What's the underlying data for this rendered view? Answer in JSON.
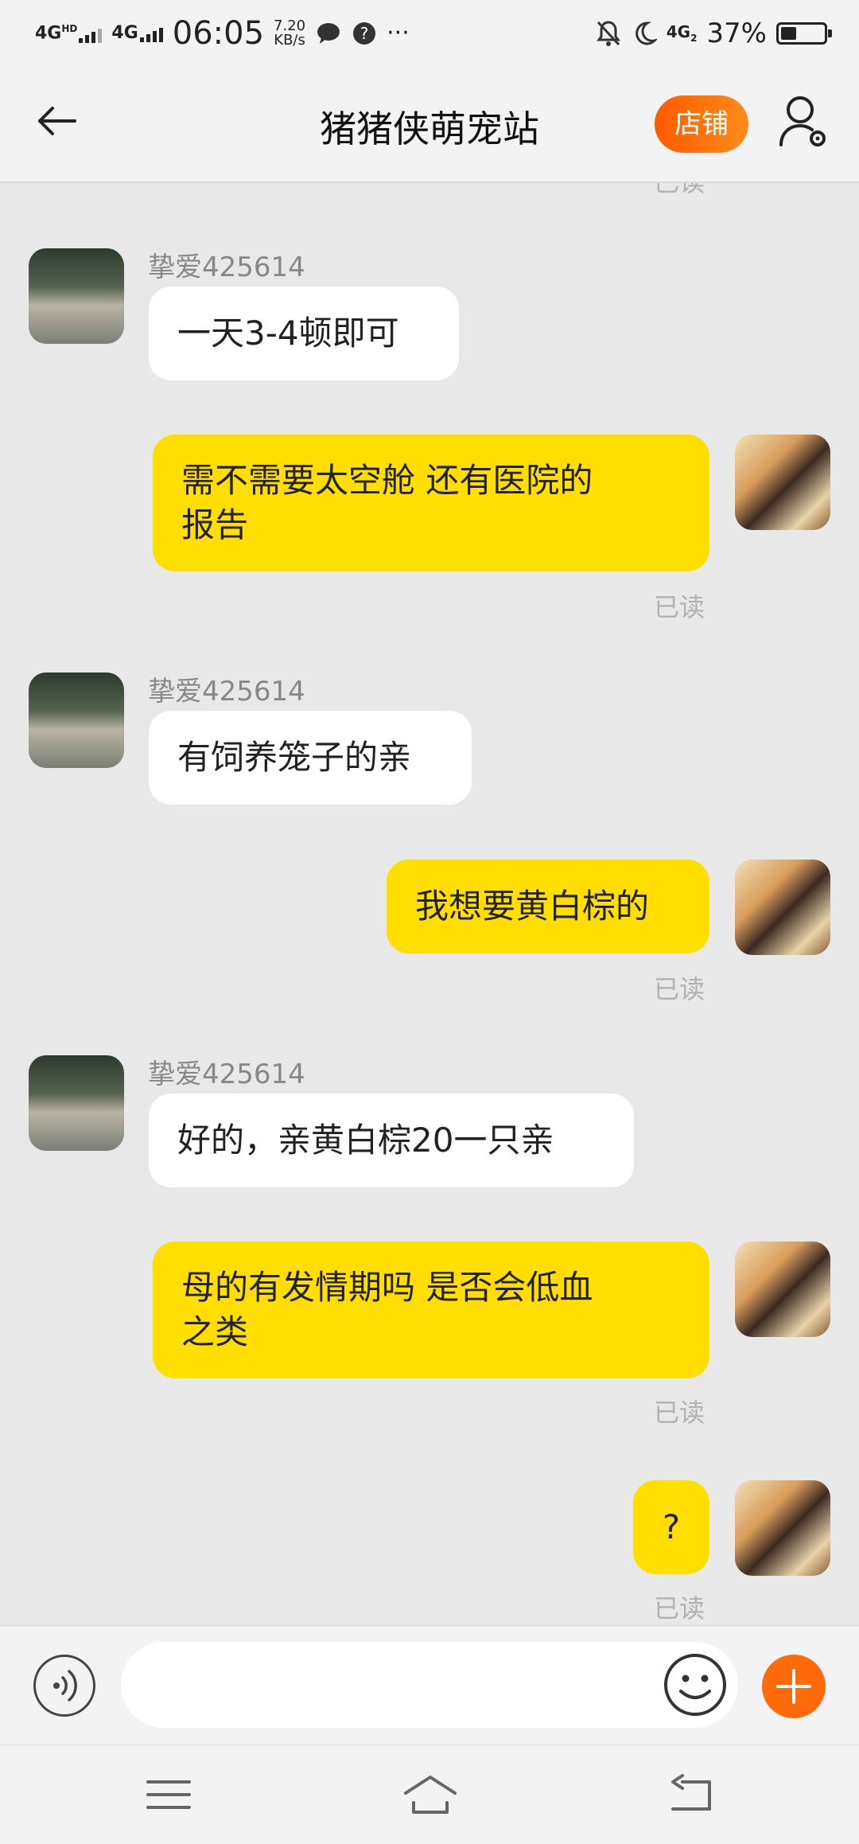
{
  "status_bar": {
    "network1": "4G",
    "network1_sup": "HD",
    "network2": "4G",
    "time": "06:05",
    "speed_value": "7.20",
    "speed_unit": "KB/s",
    "network3": "4G",
    "network3_sub": "2",
    "battery_percent_text": "37%",
    "battery_level": 0.37
  },
  "header": {
    "title": "猪猪侠萌宠站",
    "shop_button": "店铺"
  },
  "chat": {
    "top_read": "已读",
    "messages": [
      {
        "side": "in",
        "sender": "挚爱425614",
        "text": "一天3-4顿即可"
      },
      {
        "side": "out",
        "line1": "需不需要太空舱 还有医院的",
        "line2": "报告",
        "read": "已读"
      },
      {
        "side": "in",
        "sender": "挚爱425614",
        "text": "有饲养笼子的亲"
      },
      {
        "side": "out",
        "text": "我想要黄白棕的",
        "read": "已读"
      },
      {
        "side": "in",
        "sender": "挚爱425614",
        "text": "好的，亲黄白棕20一只亲"
      },
      {
        "side": "out",
        "line1": "母的有发情期吗 是否会低血",
        "line2": "之类",
        "read": "已读"
      },
      {
        "side": "out",
        "text": "?",
        "read": "已读"
      }
    ]
  },
  "input": {
    "placeholder": "",
    "value": ""
  },
  "colors": {
    "outgoing_bubble": "#ffde00",
    "incoming_bubble": "#ffffff",
    "chat_background": "#e8e8e8",
    "accent": "#ff6a0a"
  },
  "icons": [
    "back-arrow-icon",
    "profile-settings-icon",
    "voice-icon",
    "emoji-icon",
    "plus-icon",
    "menu-icon",
    "home-icon",
    "return-icon"
  ]
}
